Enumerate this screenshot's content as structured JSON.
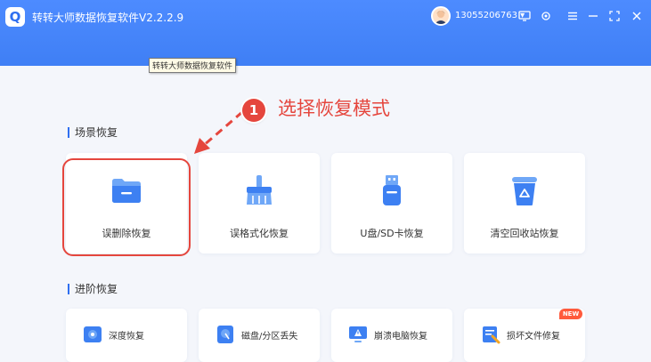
{
  "window": {
    "title": "转转大师数据恢复软件V2.2.2.9",
    "tooltip": "转转大师数据恢复软件",
    "user_phone": "13055206763 ▾"
  },
  "annotation": {
    "number": "1",
    "text": "选择恢复模式"
  },
  "scene_recovery": {
    "title": "场景恢复",
    "cards": [
      {
        "label": "误删除恢复",
        "icon": "folder-icon"
      },
      {
        "label": "误格式化恢复",
        "icon": "broom-icon"
      },
      {
        "label": "U盘/SD卡恢复",
        "icon": "usb-drive-icon"
      },
      {
        "label": "清空回收站恢复",
        "icon": "recycle-bin-icon"
      }
    ]
  },
  "advanced_recovery": {
    "title": "进阶恢复",
    "cards": [
      {
        "label": "深度恢复",
        "icon": "deep-scan-icon"
      },
      {
        "label": "磁盘/分区丢失",
        "icon": "disk-icon"
      },
      {
        "label": "崩溃电脑恢复",
        "icon": "crashed-pc-icon"
      },
      {
        "label": "损坏文件修复",
        "icon": "file-repair-icon"
      }
    ],
    "badge": "NEW"
  },
  "colors": {
    "titlebar": "#3f7ff5",
    "accent_blue": "#2f6ff0",
    "annotation_red": "#e5463d",
    "background": "#f4f6fb"
  }
}
